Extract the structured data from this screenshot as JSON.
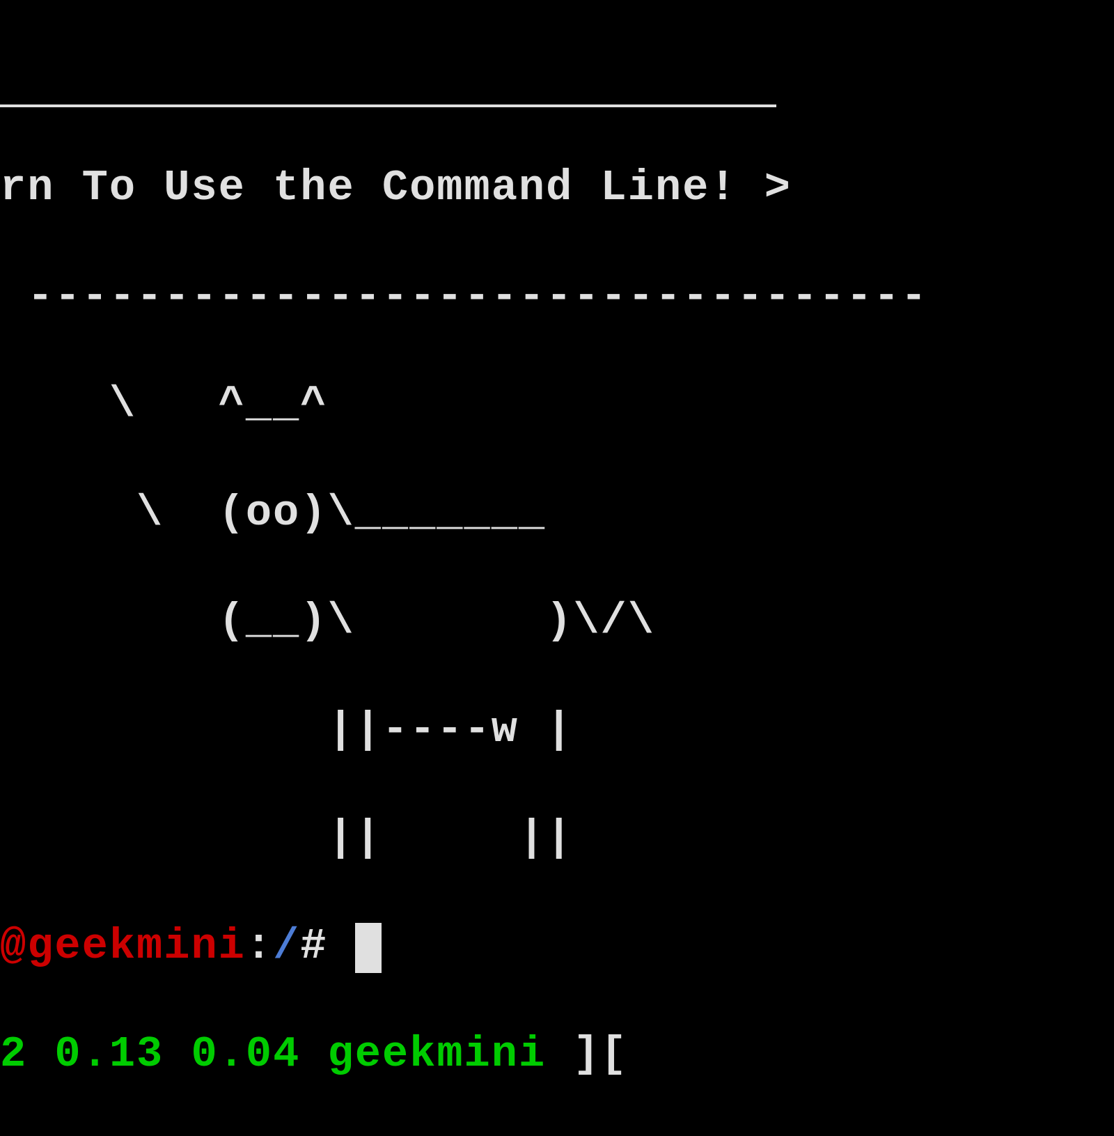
{
  "cowsay": {
    "top_border": " _________________________________",
    "message": "rn To Use the Command Line! >",
    "bottom_border": " ---------------------------------",
    "art_line_1": "    \\   ^__^",
    "art_line_2": "     \\  (oo)\\_______",
    "art_line_3": "        (__)\\       )\\/\\",
    "art_line_4": "            ||----w |",
    "art_line_5": "            ||     ||"
  },
  "prompt": {
    "user_host": "@geekmini",
    "separator": ":",
    "path": "/",
    "symbol": "# "
  },
  "status_bar": {
    "load_1": "2",
    "load_2": " 0.13",
    "load_3": " 0.04 ",
    "hostname": "geekmini ",
    "bracket": "]["
  }
}
